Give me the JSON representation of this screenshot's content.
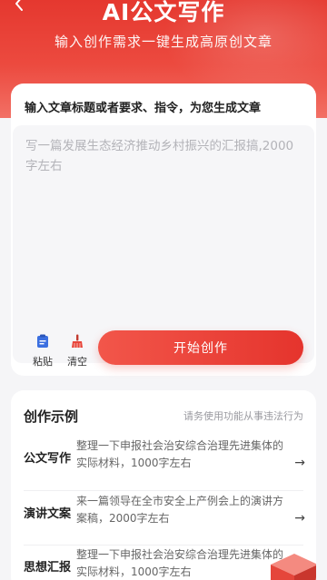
{
  "header": {
    "title": "AI公文写作",
    "subtitle": "输入创作需求一键生成高原创文章"
  },
  "input": {
    "label": "输入文章标题或者要求、指令，为您生成文章",
    "placeholder": "写一篇发展生态经济推动乡村振兴的汇报搞,2000字左右",
    "paste_label": "粘贴",
    "clear_label": "清空",
    "start_label": "开始创作"
  },
  "examples": {
    "title": "创作示例",
    "note": "请务使用功能从事违法行为",
    "items": [
      {
        "category": "公文写作",
        "text": "整理一下申报社会治安综合治理先进集体的实际材料，1000字左右"
      },
      {
        "category": "演讲文案",
        "text": "来一篇领导在全市安全上产例会上的演讲方案稿，2000字左右"
      },
      {
        "category": "思想汇报",
        "text": "整理一下申报社会治安综合治理先进集体的实际材料，1000字左右"
      }
    ]
  },
  "colors": {
    "brand": "#e5382f",
    "paste_icon": "#3b6fe0",
    "clear_icon": "#e8453a"
  }
}
